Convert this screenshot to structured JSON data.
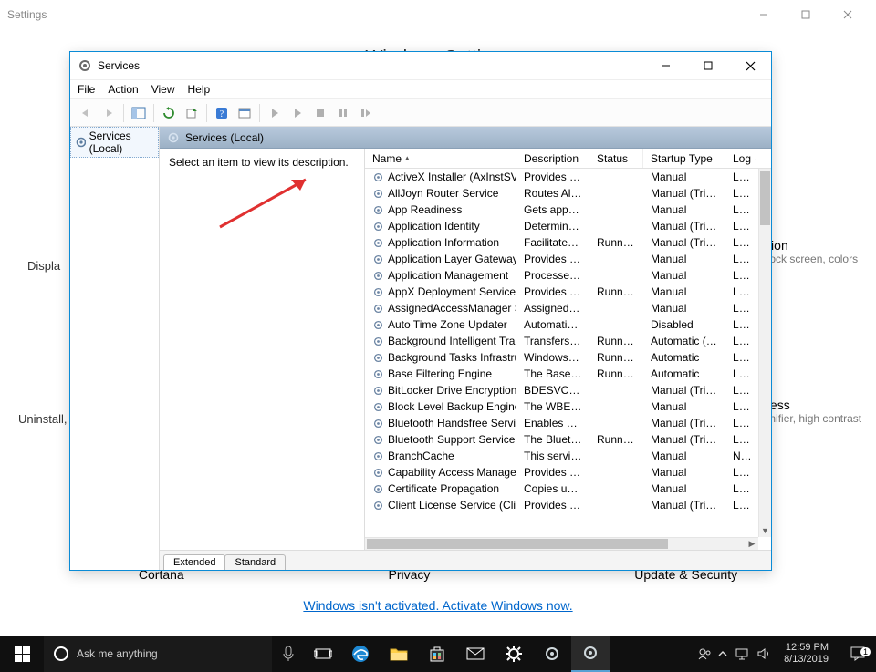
{
  "settings": {
    "title": "Settings",
    "heading": "Windows Settings",
    "labels": [
      "Displa",
      "Uninstall,"
    ],
    "personalization": {
      "title": "Personalization",
      "sub": "Background, lock screen, colors"
    },
    "ease_of_access": {
      "title": "Ease of Access",
      "sub": "Narrator, magnifier, high contrast"
    },
    "footer_categories": {
      "cortana": "Cortana",
      "privacy": "Privacy",
      "update": "Update & Security"
    },
    "activate_link": "Windows isn't activated. Activate Windows now."
  },
  "services": {
    "title": "Services",
    "menu": {
      "file": "File",
      "action": "Action",
      "view": "View",
      "help": "Help"
    },
    "tree_root": "Services (Local)",
    "heading": "Services (Local)",
    "hint": "Select an item to view its description.",
    "columns": {
      "name": "Name",
      "desc": "Description",
      "status": "Status",
      "startup": "Startup Type",
      "logon": "Log"
    },
    "tabs": {
      "extended": "Extended",
      "standard": "Standard"
    },
    "rows": [
      {
        "name": "ActiveX Installer (AxInstSV)",
        "desc": "Provides Us...",
        "status": "",
        "startup": "Manual",
        "logon": "Loc"
      },
      {
        "name": "AllJoyn Router Service",
        "desc": "Routes AllJo...",
        "status": "",
        "startup": "Manual (Trig...",
        "logon": "Loc"
      },
      {
        "name": "App Readiness",
        "desc": "Gets apps re...",
        "status": "",
        "startup": "Manual",
        "logon": "Loc"
      },
      {
        "name": "Application Identity",
        "desc": "Determines ...",
        "status": "",
        "startup": "Manual (Trig...",
        "logon": "Loc"
      },
      {
        "name": "Application Information",
        "desc": "Facilitates t...",
        "status": "Running",
        "startup": "Manual (Trig...",
        "logon": "Loc"
      },
      {
        "name": "Application Layer Gateway ...",
        "desc": "Provides su...",
        "status": "",
        "startup": "Manual",
        "logon": "Loc"
      },
      {
        "name": "Application Management",
        "desc": "Processes in...",
        "status": "",
        "startup": "Manual",
        "logon": "Loc"
      },
      {
        "name": "AppX Deployment Service (...",
        "desc": "Provides inf...",
        "status": "Running",
        "startup": "Manual",
        "logon": "Loc"
      },
      {
        "name": "AssignedAccessManager Se...",
        "desc": "AssignedAc...",
        "status": "",
        "startup": "Manual",
        "logon": "Loc"
      },
      {
        "name": "Auto Time Zone Updater",
        "desc": "Automatica...",
        "status": "",
        "startup": "Disabled",
        "logon": "Loc"
      },
      {
        "name": "Background Intelligent Tran...",
        "desc": "Transfers fil...",
        "status": "Running",
        "startup": "Automatic (D...",
        "logon": "Loc"
      },
      {
        "name": "Background Tasks Infrastru...",
        "desc": "Windows in...",
        "status": "Running",
        "startup": "Automatic",
        "logon": "Loc"
      },
      {
        "name": "Base Filtering Engine",
        "desc": "The Base Fil...",
        "status": "Running",
        "startup": "Automatic",
        "logon": "Loc"
      },
      {
        "name": "BitLocker Drive Encryption ...",
        "desc": "BDESVC hos...",
        "status": "",
        "startup": "Manual (Trig...",
        "logon": "Loc"
      },
      {
        "name": "Block Level Backup Engine ...",
        "desc": "The WBENG...",
        "status": "",
        "startup": "Manual",
        "logon": "Loc"
      },
      {
        "name": "Bluetooth Handsfree Service",
        "desc": "Enables wir...",
        "status": "",
        "startup": "Manual (Trig...",
        "logon": "Loc"
      },
      {
        "name": "Bluetooth Support Service",
        "desc": "The Bluetoo...",
        "status": "Running",
        "startup": "Manual (Trig...",
        "logon": "Loc"
      },
      {
        "name": "BranchCache",
        "desc": "This service ...",
        "status": "",
        "startup": "Manual",
        "logon": "Net"
      },
      {
        "name": "Capability Access Manager ...",
        "desc": "Provides fac...",
        "status": "",
        "startup": "Manual",
        "logon": "Loc"
      },
      {
        "name": "Certificate Propagation",
        "desc": "Copies user ...",
        "status": "",
        "startup": "Manual",
        "logon": "Loc"
      },
      {
        "name": "Client License Service (ClipS...",
        "desc": "Provides inf...",
        "status": "",
        "startup": "Manual (Trig...",
        "logon": "Loc"
      }
    ]
  },
  "taskbar": {
    "search_placeholder": "Ask me anything",
    "time": "12:59 PM",
    "date": "8/13/2019",
    "notif_count": "1"
  }
}
